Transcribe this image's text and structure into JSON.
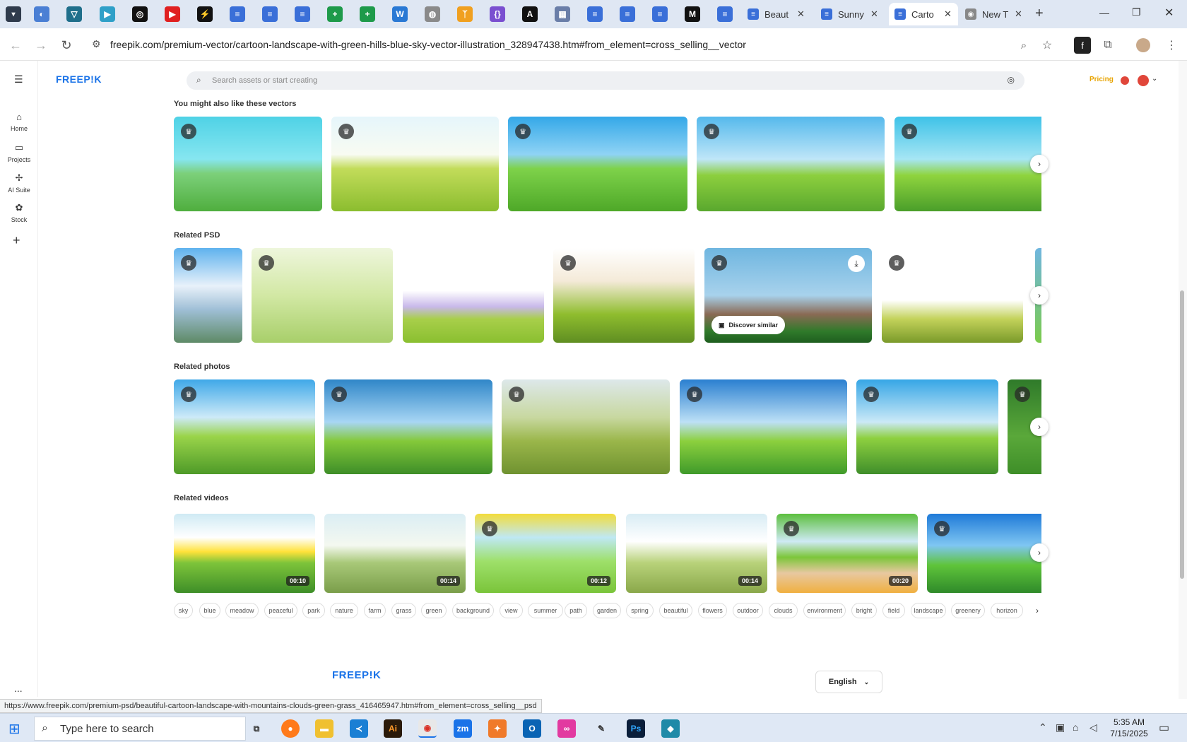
{
  "browser": {
    "tabs": [
      {
        "title": "Beaut",
        "active": false
      },
      {
        "title": "Sunny",
        "active": false
      },
      {
        "title": "Carto",
        "active": true
      },
      {
        "title": "New T",
        "active": false
      }
    ],
    "new_tab_label": "+",
    "url": "freepik.com/premium-vector/cartoon-landscape-with-green-hills-blue-sky-vector-illustration_328947438.htm#from_element=cross_selling__vector",
    "status_url": "https://www.freepik.com/premium-psd/beautiful-cartoon-landscape-with-mountains-clouds-green-grass_416465947.htm#from_element=cross_selling__psd"
  },
  "site": {
    "logo": "FREEP!K",
    "search_placeholder": "Search assets or start creating",
    "pricing_label": "Pricing",
    "accent": "#1a73e8",
    "pricing_color": "#e8a400"
  },
  "sidebar": {
    "items": [
      {
        "label": "Home",
        "icon": "home-icon"
      },
      {
        "label": "Projects",
        "icon": "folder-icon"
      },
      {
        "label": "AI Suite",
        "icon": "sparkle-icon"
      },
      {
        "label": "Stock",
        "icon": "stock-icon"
      }
    ],
    "more_label": "..."
  },
  "sections": {
    "vectors_title": "You might also like these vectors",
    "psd_title": "Related PSD",
    "photos_title": "Related photos",
    "videos_title": "Related videos",
    "discover_label": "Discover similar"
  },
  "videos": {
    "durations": [
      "00:10",
      "00:14",
      "00:12",
      "00:14",
      "00:20"
    ]
  },
  "tags": [
    "sky",
    "blue",
    "meadow",
    "peaceful",
    "park",
    "nature",
    "farm",
    "grass",
    "green",
    "background",
    "view",
    "summer",
    "path",
    "garden",
    "spring",
    "beautiful",
    "flowers",
    "outdoor",
    "clouds",
    "environment",
    "bright",
    "field",
    "landscape",
    "greenery",
    "horizon"
  ],
  "footer": {
    "logo": "FREEP!K",
    "language": "English"
  },
  "taskbar": {
    "search_placeholder": "Type here to search",
    "time": "5:35 AM",
    "date": "7/15/2025"
  }
}
